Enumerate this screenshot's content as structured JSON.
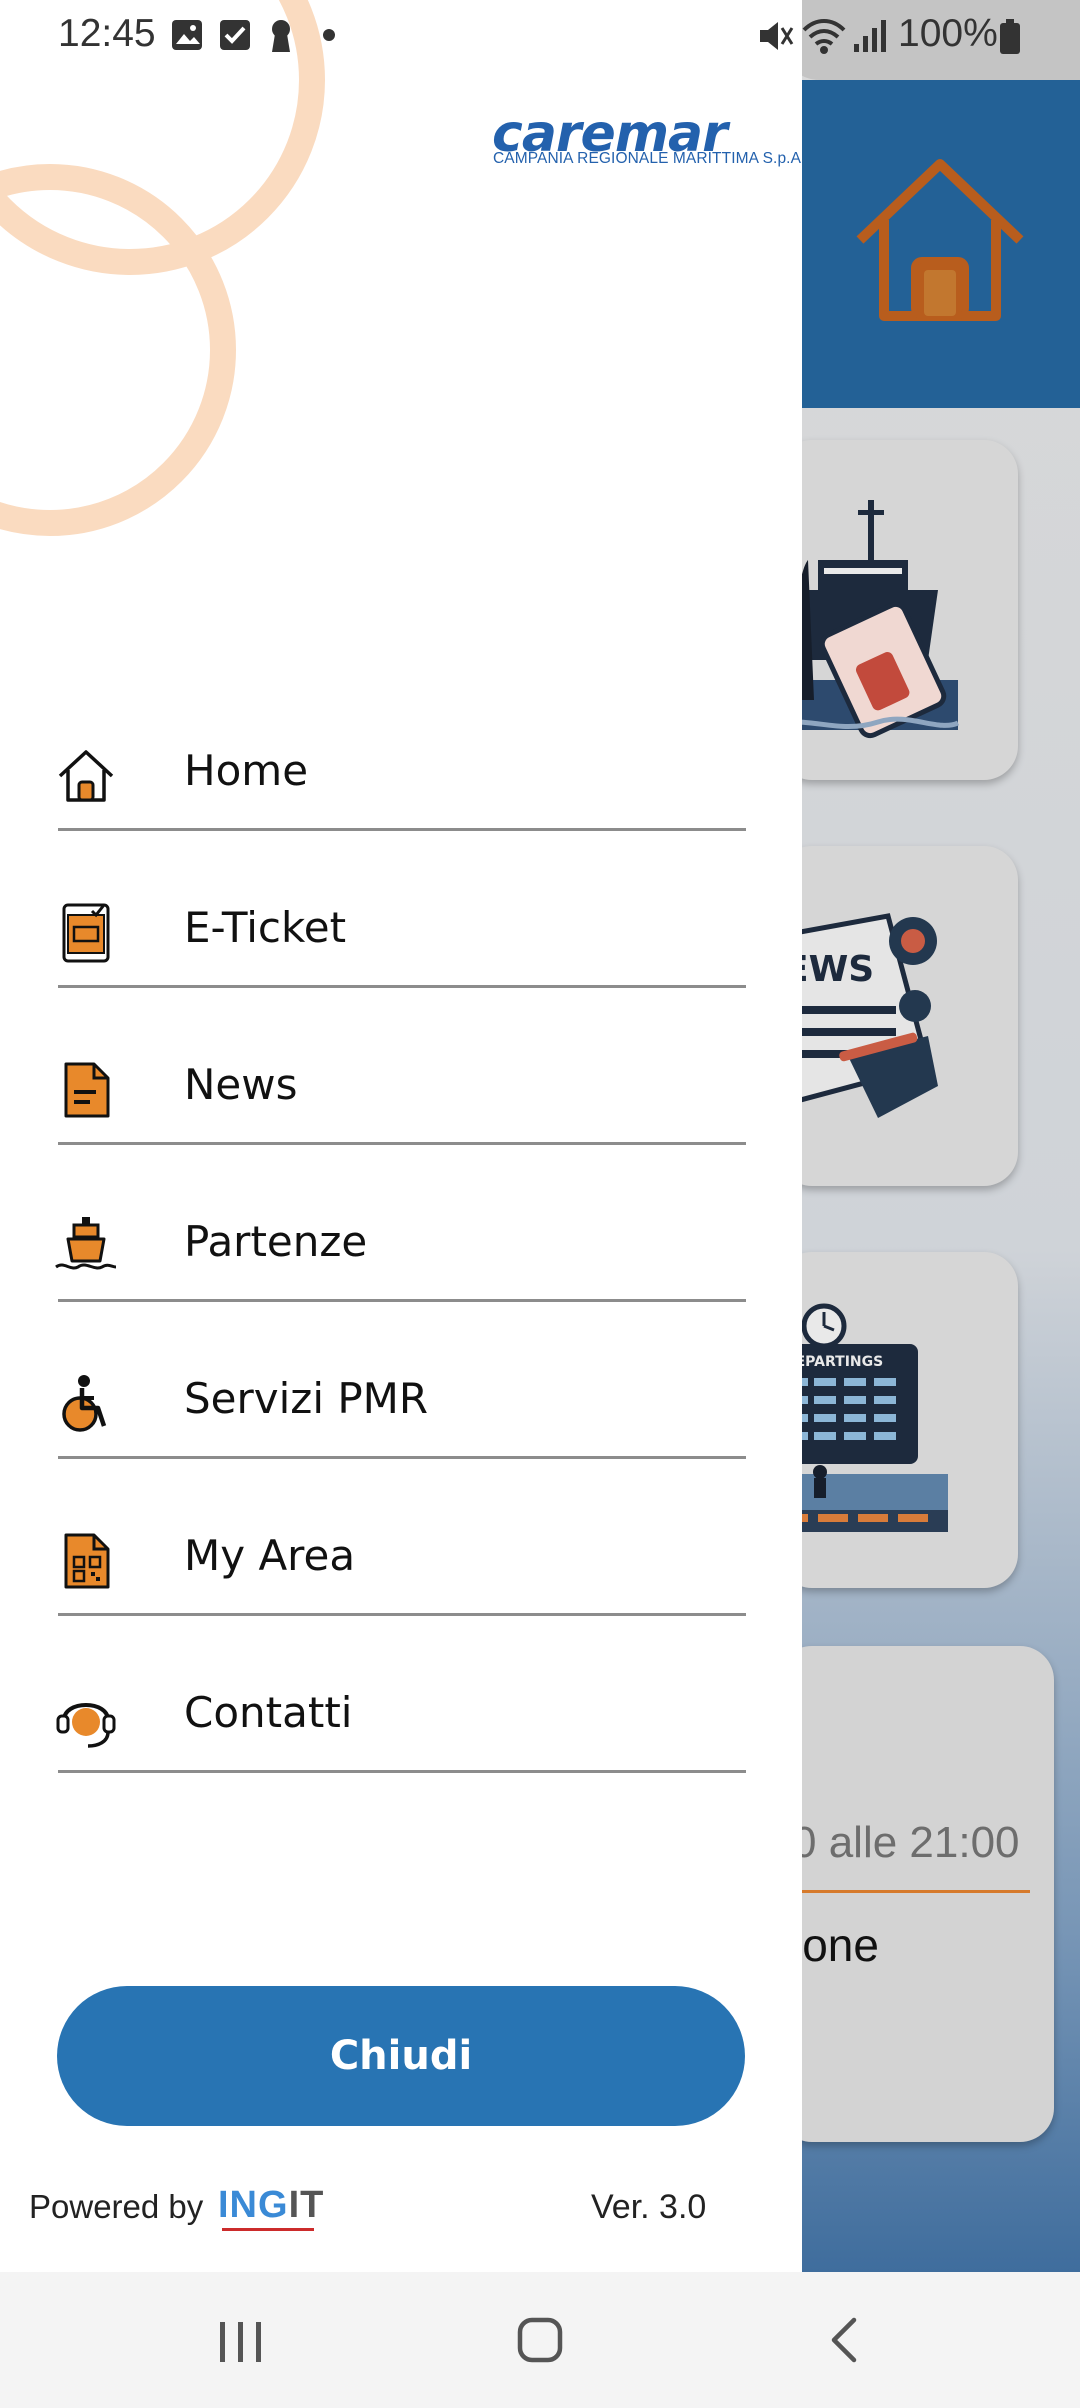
{
  "status_bar": {
    "time": "12:45",
    "battery": "100%",
    "icons": [
      "gallery-icon",
      "checkbox-icon",
      "keyhole-icon",
      "dot-icon",
      "mute-icon",
      "wifi-icon",
      "signal-icon",
      "battery-icon"
    ]
  },
  "drawer": {
    "brand": {
      "name": "caremar",
      "tagline": "CAMPANIA REGIONALE MARITTIMA S.p.A.",
      "color": "#2361ad"
    },
    "menu": [
      {
        "label": "Home",
        "icon": "home-icon"
      },
      {
        "label": "E-Ticket",
        "icon": "eticket-icon"
      },
      {
        "label": "News",
        "icon": "news-document-icon"
      },
      {
        "label": "Partenze",
        "icon": "ship-icon"
      },
      {
        "label": "Servizi PMR",
        "icon": "wheelchair-icon"
      },
      {
        "label": "My Area",
        "icon": "qr-document-icon"
      },
      {
        "label": "Contatti",
        "icon": "headset-icon"
      }
    ],
    "close_label": "Chiudi",
    "powered_by": "Powered by",
    "powered_brand_a": "ING",
    "powered_brand_b": "IT",
    "version": "Ver. 3.0",
    "accent_color": "#2874b3",
    "icon_accent": "#e8892b"
  },
  "background": {
    "hours_text": "0 alle 21:00",
    "section_word": "ione",
    "header_color": "#236196"
  },
  "nav_bar": {
    "buttons": [
      "recent-apps",
      "home",
      "back"
    ]
  }
}
